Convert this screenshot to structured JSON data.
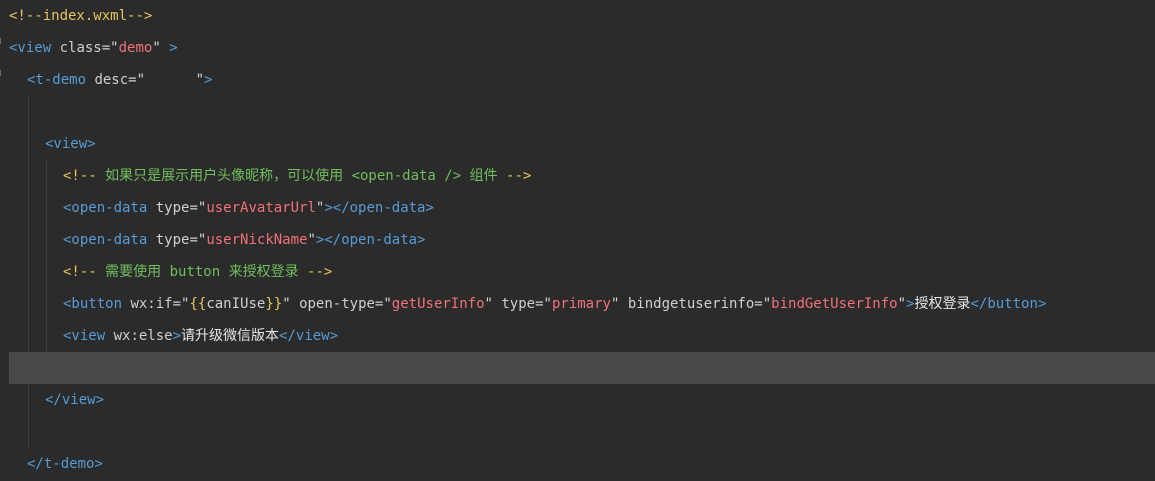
{
  "editor": {
    "language": "wxml",
    "colors": {
      "background": "#2b2b2b",
      "current_line": "#484848",
      "tag": "#569cd6",
      "attribute_value": "#f07178",
      "comment_delimiter": "#e8c55b",
      "comment_text": "#6fbf5c"
    },
    "lines": {
      "l1": {
        "comment_open": "<!--",
        "comment_text": "index.wxml",
        "comment_close": "-->"
      },
      "l2": {
        "open": "<view",
        "attr": " class=",
        "q1": "\"",
        "value": "demo",
        "q2": "\"",
        "close": " >"
      },
      "l3": {
        "open": "<t-demo",
        "attr": " desc=",
        "q1": "\"",
        "value": "      ",
        "q2": "\"",
        "close": ">"
      },
      "l5": {
        "open": "<view",
        "close": ">"
      },
      "l6": {
        "comment_open": "<!--",
        "comment_text": " 如果只是展示用户头像昵称，可以使用 <open-data /> 组件 ",
        "comment_close": "-->"
      },
      "l7": {
        "open": "<open-data",
        "attr": " type=",
        "q1": "\"",
        "value": "userAvatarUrl",
        "q2": "\"",
        "close": ">",
        "end_tag": "</open-data>"
      },
      "l8": {
        "open": "<open-data",
        "attr": " type=",
        "q1": "\"",
        "value": "userNickName",
        "q2": "\"",
        "close": ">",
        "end_tag": "</open-data>"
      },
      "l9": {
        "comment_open": "<!--",
        "comment_text": " 需要使用 button 来授权登录 ",
        "comment_close": "-->"
      },
      "l10": {
        "open": "<button",
        "attr1": " wx:if=",
        "q1": "\"",
        "mustache_open": "{{",
        "expr": "canIUse",
        "mustache_close": "}}",
        "q2": "\"",
        "attr2": " open-type=",
        "q3": "\"",
        "value2": "getUserInfo",
        "q4": "\"",
        "attr3": " type=",
        "q5": "\"",
        "value3": "primary",
        "q6": "\"",
        "attr4": " bindgetuserinfo=",
        "q7": "\"",
        "value4": "bindGetUserInfo",
        "q8": "\"",
        "close": ">",
        "text": "授权登录",
        "end_tag": "</button>"
      },
      "l11": {
        "open": "<view",
        "attr": " wx:else",
        "close": ">",
        "text": "请升级微信版本",
        "end_tag": "</view>"
      },
      "l13": {
        "end_tag": "</view>"
      },
      "l15": {
        "end_tag": "</t-demo>"
      }
    }
  }
}
